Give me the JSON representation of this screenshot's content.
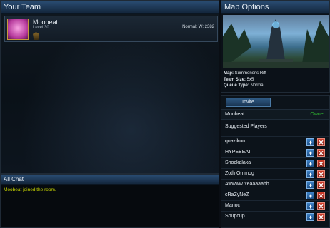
{
  "team": {
    "title": "Your Team",
    "member": {
      "name": "Moobeat",
      "level": "Level 30",
      "elo": "Normal: W: 2382"
    }
  },
  "chat": {
    "title": "All Chat",
    "messages": [
      "Moobeat joined the room."
    ],
    "message_color": "#c6d400"
  },
  "map_options": {
    "title": "Map Options",
    "map_label": "Map:",
    "map_value": "Summoner's Rift",
    "team_size_label": "Team Size:",
    "team_size_value": "5x5",
    "queue_label": "Queue Type:",
    "queue_value": "Normal"
  },
  "invite": {
    "button_label": "Invite",
    "owner": {
      "name": "Moobeat",
      "tag": "Owner",
      "tag_color": "#2fb330"
    },
    "suggested_title": "Suggested Players",
    "players": [
      "quazikun",
      "HYPEBEAT",
      "Shockalaka",
      "Zoth Ommog",
      "Awwww Yeaaaaahh",
      "cRaZyNeZ",
      "Manoc",
      "Soupcup"
    ],
    "add_symbol": "+",
    "remove_symbol": "✕"
  }
}
